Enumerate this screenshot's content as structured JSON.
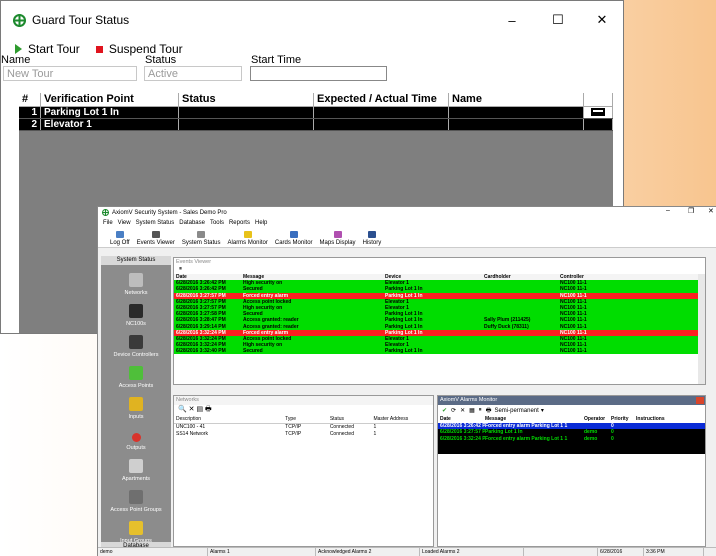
{
  "colors": {
    "grant_green": "#00dd00",
    "alarm_red": "#ff2020",
    "selected_blue": "#0a2bd6",
    "tour_row": "#000000"
  },
  "guard_tour": {
    "title": "Guard Tour Status",
    "window_controls": {
      "minimize": "–",
      "maximize": "☐",
      "close": "✕"
    },
    "toolbar": {
      "start": "Start Tour",
      "suspend": "Suspend Tour"
    },
    "fields": {
      "name_label": "Name",
      "name_value": "New Tour",
      "status_label": "Status",
      "status_value": "Active",
      "start_label": "Start Time",
      "start_value": ""
    },
    "table": {
      "headers": [
        "#",
        "Verification Point",
        "Status",
        "Expected / Actual Time",
        "Name",
        ""
      ],
      "rows": [
        {
          "num": "1",
          "point": "Parking Lot 1 In",
          "status": "",
          "time": "",
          "name": ""
        },
        {
          "num": "2",
          "point": "Elevator 1",
          "status": "",
          "time": "",
          "name": ""
        }
      ]
    }
  },
  "axiom": {
    "title": "AxiomV Security System  - Sales Demo Pro",
    "window_controls": {
      "minimize": "–",
      "maximize": "❐",
      "close": "✕"
    },
    "menu": [
      "File",
      "View",
      "System Status",
      "Database",
      "Tools",
      "Reports",
      "Help"
    ],
    "toolbar": [
      "Log Off",
      "Events Viewer",
      "System Status",
      "Alarms Monitor",
      "Cards Monitor",
      "Maps Display",
      "History"
    ],
    "sidebar": {
      "header": "System Status",
      "items": [
        "Networks",
        "NC100s",
        "Device Controllers",
        "Access Points",
        "Inputs",
        "Outputs",
        "Apartments",
        "Access Point Groups",
        "Input Groups"
      ],
      "footer": "Database"
    },
    "events": {
      "caption": "Events Viewer",
      "pause": "⏸",
      "headers": [
        "Date",
        "Message",
        "Device",
        "Cardholder",
        "Controller"
      ],
      "rows": [
        {
          "date": "6/28/2016 3:26:42 PM",
          "msg": "High security on",
          "dev": "Elevator 1",
          "card": "",
          "ctrl": "NC100 11-1",
          "kind": "green"
        },
        {
          "date": "6/28/2016 3:26:42 PM",
          "msg": "Secured",
          "dev": "Parking Lot 1 In",
          "card": "",
          "ctrl": "NC100 11-1",
          "kind": "green"
        },
        {
          "date": "6/28/2016 3:27:57 PM",
          "msg": "Forced entry alarm",
          "dev": "Parking Lot 1 In",
          "card": "",
          "ctrl": "NC100 11-1",
          "kind": "red"
        },
        {
          "date": "6/28/2016 3:27:57 PM",
          "msg": "Access point locked",
          "dev": "Elevator 1",
          "card": "",
          "ctrl": "NC100 11-1",
          "kind": "green"
        },
        {
          "date": "6/28/2016 3:27:57 PM",
          "msg": "High security on",
          "dev": "Elevator 1",
          "card": "",
          "ctrl": "NC100 11-1",
          "kind": "green"
        },
        {
          "date": "6/28/2016 3:27:58 PM",
          "msg": "Secured",
          "dev": "Parking Lot 1 In",
          "card": "",
          "ctrl": "NC100 11-1",
          "kind": "green"
        },
        {
          "date": "6/28/2016 3:28:47 PM",
          "msg": "Access granted: reader",
          "dev": "Parking Lot 1 In",
          "card": "Sally  Plum (211425)",
          "ctrl": "NC100 11-1",
          "kind": "green"
        },
        {
          "date": "6/28/2016 3:29:14 PM",
          "msg": "Access granted: reader",
          "dev": "Parking Lot 1 In",
          "card": "Duffy Duck (78311)",
          "ctrl": "NC100 11-1",
          "kind": "green"
        },
        {
          "date": "6/28/2016 3:32:24 PM",
          "msg": "Forced entry alarm",
          "dev": "Parking Lot 1 In",
          "card": "",
          "ctrl": "NC100 11-1",
          "kind": "red"
        },
        {
          "date": "6/28/2016 3:32:24 PM",
          "msg": "Access point locked",
          "dev": "Elevator 1",
          "card": "",
          "ctrl": "NC100 11-1",
          "kind": "green"
        },
        {
          "date": "6/28/2016 3:32:24 PM",
          "msg": "High security on",
          "dev": "Elevator 1",
          "card": "",
          "ctrl": "NC100 11-1",
          "kind": "green"
        },
        {
          "date": "6/28/2016 3:32:40 PM",
          "msg": "Secured",
          "dev": "Parking Lot 1 In",
          "card": "",
          "ctrl": "NC100 11-1",
          "kind": "green"
        }
      ]
    },
    "networks": {
      "caption": "Networks",
      "tools": "🔍 ✕ ▤ 🖶",
      "headers": [
        "Description",
        "Type",
        "Status",
        "Master Address"
      ],
      "rows": [
        {
          "desc": "UNC100 - 41",
          "type": "TCP/IP",
          "status": "Connected",
          "addr": "1"
        },
        {
          "desc": "SS14 Network",
          "type": "TCP/IP",
          "status": "Connected",
          "addr": "1"
        }
      ]
    },
    "alarms": {
      "caption": "AxiomV Alarms Monitor",
      "mode": "Semi-permanent",
      "headers": [
        "Date",
        "Message",
        "Operator",
        "Priority",
        "Instructions"
      ],
      "rows": [
        {
          "date": "6/28/2016 3:26:42 PM",
          "msg": "Forced entry alarm Parking Lot 1 1",
          "op": "",
          "pri": "0",
          "ins": "",
          "kind": "selected"
        },
        {
          "date": "6/28/2016 3:27:57 PM",
          "msg": "Parking Lot 1 In",
          "op": "demo",
          "pri": "0",
          "ins": "",
          "kind": "green"
        },
        {
          "date": "6/28/2016 3:32:24 PM",
          "msg": "Forced entry alarm Parking Lot 1 1",
          "op": "demo",
          "pri": "0",
          "ins": "",
          "kind": "green"
        }
      ]
    },
    "statusbar": [
      "demo",
      "Alarms 1",
      "Acknowledged Alarms 2",
      "Loaded Alarms 2",
      "",
      "6/28/2016",
      "3:36 PM"
    ]
  }
}
